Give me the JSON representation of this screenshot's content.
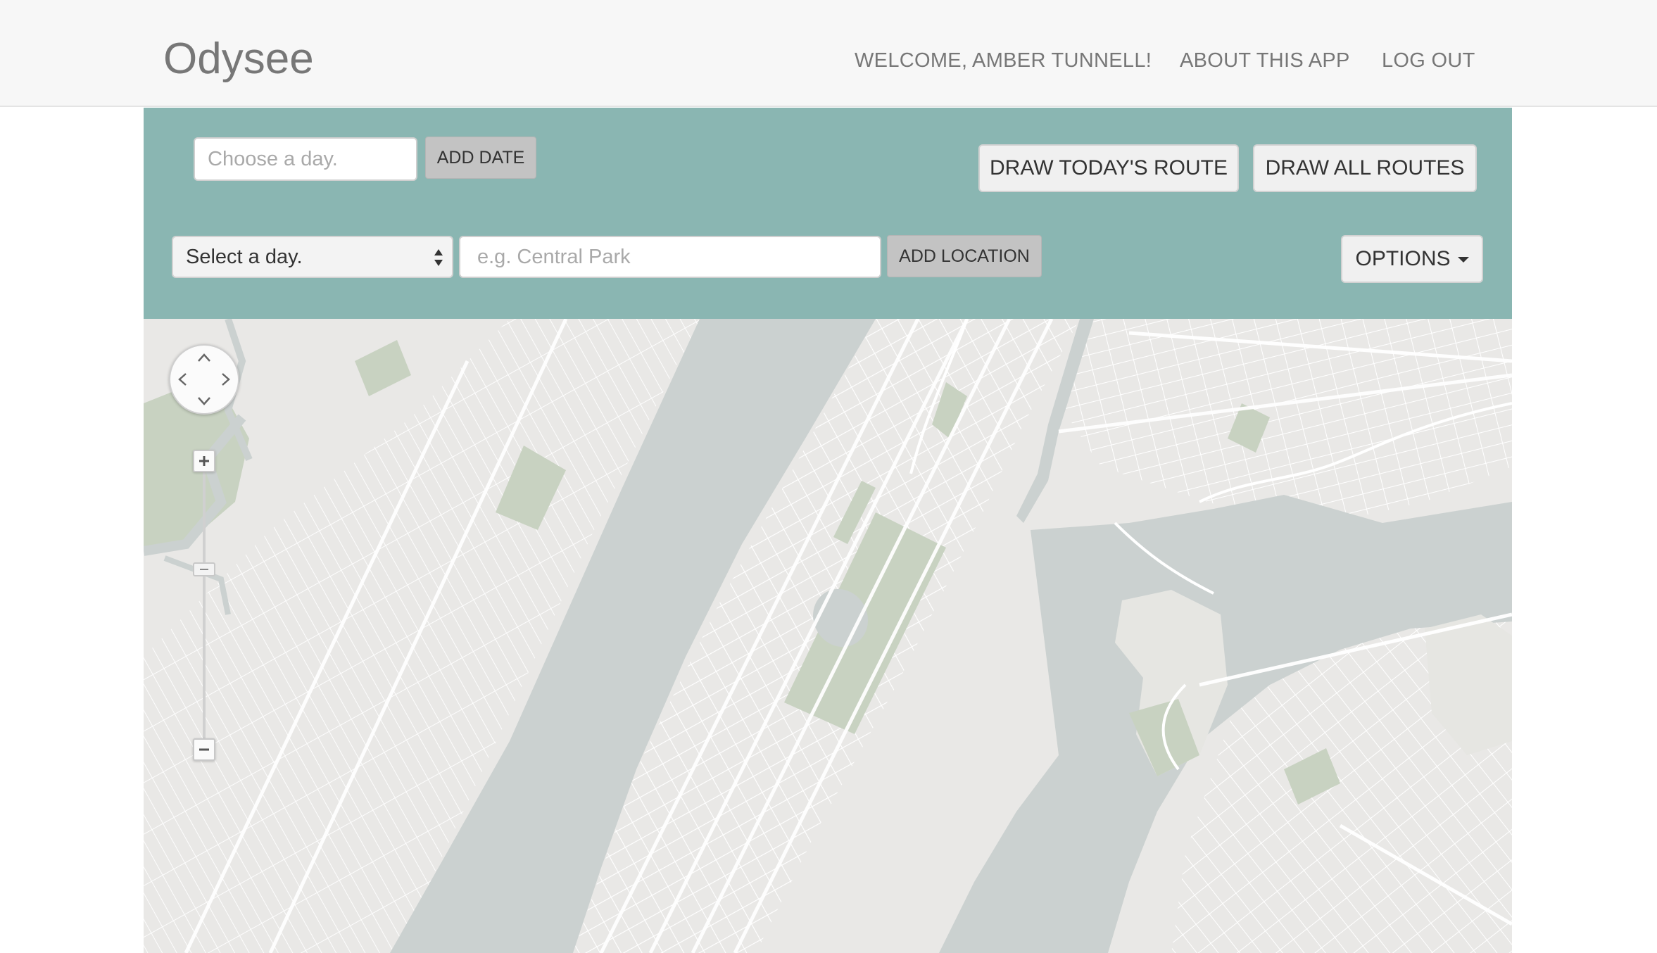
{
  "navbar": {
    "brand": "Odysee",
    "links": {
      "welcome": "WELCOME, AMBER TUNNELL!",
      "about": "ABOUT THIS APP",
      "logout": "LOG OUT"
    }
  },
  "toolbar": {
    "date_input": {
      "value": "",
      "placeholder": "Choose a day."
    },
    "add_date_label": "ADD DATE",
    "draw_today_label": "DRAW TODAY'S ROUTE",
    "draw_all_label": "DRAW ALL ROUTES",
    "day_select": {
      "selected": "Select a day."
    },
    "location_input": {
      "value": "",
      "placeholder": "e.g. Central Park"
    },
    "add_location_label": "ADD LOCATION",
    "options_label": "OPTIONS"
  },
  "map": {
    "controls": {
      "pan_icons": [
        "pan-up-icon",
        "pan-down-icon",
        "pan-left-icon",
        "pan-right-icon"
      ],
      "zoom_in_icon": "plus-icon",
      "zoom_out_icon": "minus-icon"
    }
  },
  "colors": {
    "navbar_bg": "#f7f7f7",
    "panel_bg": "#8ab6b2",
    "map_land": "#e9e8e6",
    "map_water": "#cbd1d0",
    "map_park": "#c8d2c1",
    "map_road": "#ffffff"
  }
}
